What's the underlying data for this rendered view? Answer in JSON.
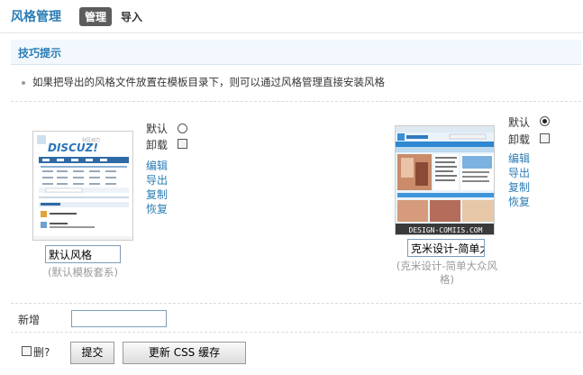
{
  "header": {
    "title": "风格管理",
    "tabs": [
      {
        "label": "管理",
        "active": true
      },
      {
        "label": "导入",
        "active": false
      }
    ]
  },
  "tips": {
    "heading": "技巧提示",
    "items": [
      "如果把导出的风格文件放置在模板目录下，则可以通过风格管理直接安装风格"
    ]
  },
  "styles": [
    {
      "name": "默认风格",
      "template": "(默认模板套系)",
      "default_label": "默认",
      "uninstall_label": "卸载",
      "is_default": false,
      "uninstall_checked": false,
      "actions": [
        "编辑",
        "导出",
        "复制",
        "恢复"
      ],
      "preview_logo": "DISCUZ!"
    },
    {
      "name": "克米设计-简单大",
      "template": "(克米设计-简单大众风格)",
      "default_label": "默认",
      "uninstall_label": "卸载",
      "is_default": true,
      "uninstall_checked": false,
      "actions": [
        "编辑",
        "导出",
        "复制",
        "恢复"
      ],
      "preview_caption": "DESIGN-COMIIS.COM"
    }
  ],
  "new_style": {
    "label": "新增",
    "value": ""
  },
  "footer": {
    "delete_label": "删?",
    "delete_checked": false,
    "submit_label": "提交",
    "update_css_label": "更新 CSS 缓存"
  },
  "colors": {
    "accent": "#2b7db5",
    "tips_bg": "#f2f8fd",
    "tab_active_bg": "#5c5c5c"
  }
}
